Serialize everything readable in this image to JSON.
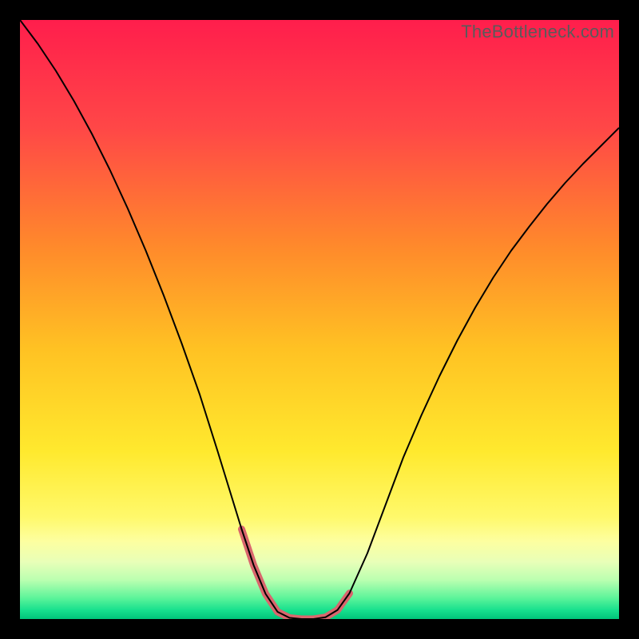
{
  "watermark": "TheBottleneck.com",
  "chart_data": {
    "type": "line",
    "title": "",
    "xlabel": "",
    "ylabel": "",
    "xlim": [
      0,
      100
    ],
    "ylim": [
      0,
      100
    ],
    "background_gradient_stops": [
      {
        "offset": 0.0,
        "color": "#ff1e4c"
      },
      {
        "offset": 0.18,
        "color": "#ff4747"
      },
      {
        "offset": 0.38,
        "color": "#ff8a2b"
      },
      {
        "offset": 0.55,
        "color": "#ffc223"
      },
      {
        "offset": 0.72,
        "color": "#ffe92e"
      },
      {
        "offset": 0.83,
        "color": "#fff96b"
      },
      {
        "offset": 0.87,
        "color": "#fdffa0"
      },
      {
        "offset": 0.905,
        "color": "#e8ffb8"
      },
      {
        "offset": 0.935,
        "color": "#baffb0"
      },
      {
        "offset": 0.965,
        "color": "#5cf49a"
      },
      {
        "offset": 0.985,
        "color": "#18e08e"
      },
      {
        "offset": 1.0,
        "color": "#00c47a"
      }
    ],
    "series": [
      {
        "name": "bottleneck-curve",
        "color": "#000000",
        "width": 2,
        "x": [
          0,
          3,
          6,
          9,
          12,
          15,
          18,
          21,
          24,
          27,
          30,
          33,
          35,
          37,
          39,
          41,
          43,
          45,
          47,
          49,
          51,
          53,
          55,
          58,
          61,
          64,
          67,
          70,
          73,
          76,
          79,
          82,
          85,
          88,
          91,
          94,
          97,
          100
        ],
        "y": [
          100,
          96,
          91.5,
          86.5,
          81,
          75,
          68.5,
          61.5,
          54,
          46,
          37.5,
          28,
          21.5,
          15,
          9,
          4.2,
          1.2,
          0.2,
          0,
          0,
          0.3,
          1.5,
          4.3,
          11,
          19,
          27,
          34,
          40.5,
          46.5,
          52,
          57,
          61.5,
          65.5,
          69.3,
          72.8,
          76,
          79,
          82
        ]
      },
      {
        "name": "highlight-valley",
        "color": "#d9666d",
        "width": 9,
        "cap": "round",
        "x": [
          37,
          39,
          41,
          43,
          45,
          47,
          49,
          51,
          53,
          55
        ],
        "y": [
          15,
          9,
          4.2,
          1.2,
          0.2,
          0,
          0,
          0.3,
          1.5,
          4.3
        ]
      }
    ]
  }
}
